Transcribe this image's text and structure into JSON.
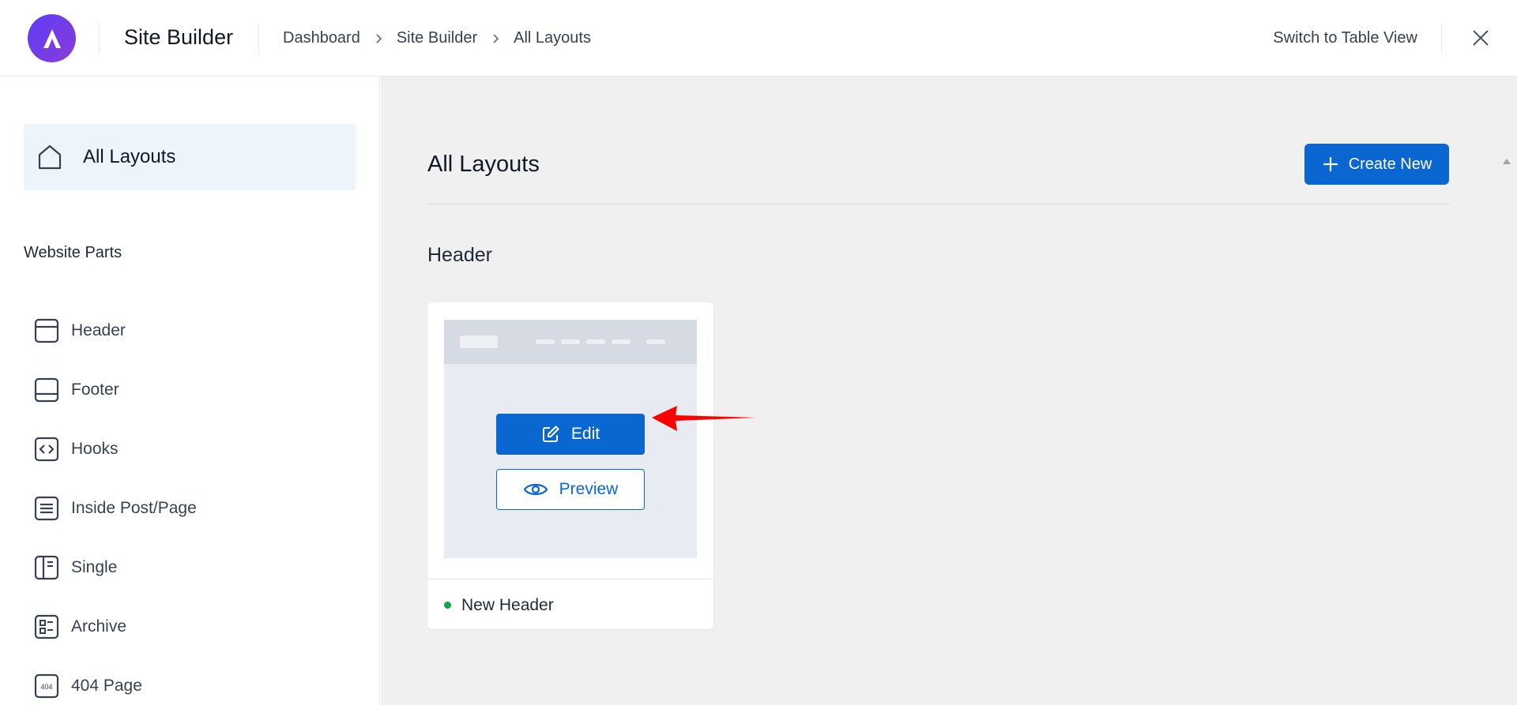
{
  "app": {
    "title": "Site Builder"
  },
  "breadcrumb": [
    "Dashboard",
    "Site Builder",
    "All Layouts"
  ],
  "header_actions": {
    "switch_view": "Switch to Table View"
  },
  "sidebar": {
    "active_item": "All Layouts",
    "section_title": "Website Parts",
    "items": [
      {
        "label": "Header",
        "icon": "header-layout-icon"
      },
      {
        "label": "Footer",
        "icon": "footer-layout-icon"
      },
      {
        "label": "Hooks",
        "icon": "code-brackets-icon"
      },
      {
        "label": "Inside Post/Page",
        "icon": "text-lines-icon"
      },
      {
        "label": "Single",
        "icon": "single-layout-icon"
      },
      {
        "label": "Archive",
        "icon": "archive-grid-icon"
      },
      {
        "label": "404 Page",
        "icon": "error-404-icon"
      }
    ]
  },
  "main": {
    "title": "All Layouts",
    "create_label": "Create New",
    "group_title": "Header",
    "card": {
      "edit_label": "Edit",
      "preview_label": "Preview",
      "name": "New Header",
      "status_color": "#16a34a"
    }
  },
  "colors": {
    "primary": "#0a66d1",
    "active_bg": "#eef4fc",
    "annotation_arrow": "#ff0000"
  }
}
